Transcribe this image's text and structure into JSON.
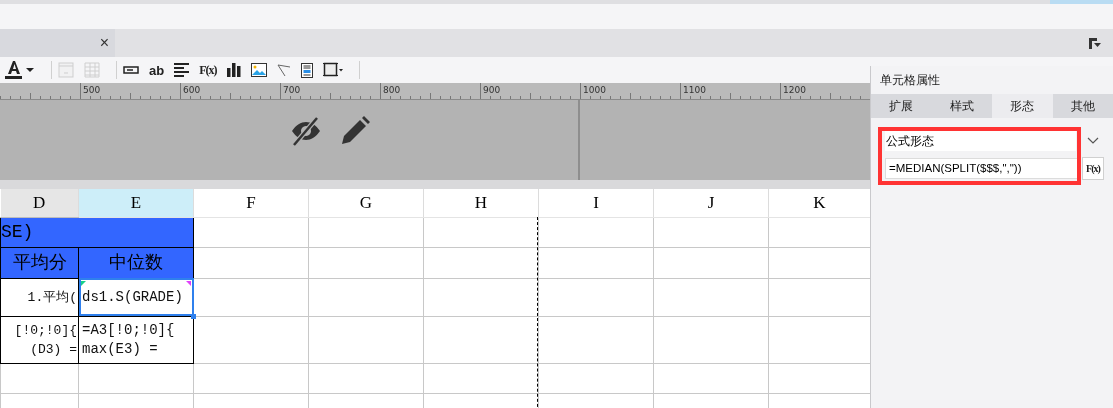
{
  "document_tab": {
    "close_glyph": "×",
    "selected": true
  },
  "toolbar": [
    {
      "kind": "font-color",
      "disabled": false
    },
    {
      "kind": "separator"
    },
    {
      "kind": "frame",
      "disabled": true
    },
    {
      "kind": "grid",
      "disabled": true
    },
    {
      "kind": "separator"
    },
    {
      "kind": "textbox",
      "disabled": false
    },
    {
      "kind": "text",
      "label": "ab",
      "disabled": false
    },
    {
      "kind": "align",
      "disabled": false
    },
    {
      "kind": "formula",
      "label": "F(x)",
      "disabled": false
    },
    {
      "kind": "chart",
      "disabled": false
    },
    {
      "kind": "image",
      "disabled": false
    },
    {
      "kind": "slash",
      "disabled": false
    },
    {
      "kind": "report",
      "disabled": false
    },
    {
      "kind": "border",
      "disabled": false
    },
    {
      "kind": "separator"
    }
  ],
  "ruler": {
    "labels": [
      "500",
      "600",
      "700",
      "800",
      "900",
      "1000",
      "1100",
      "1200"
    ]
  },
  "sheet": {
    "columns": [
      {
        "label": "D",
        "selected": false,
        "shaded": true
      },
      {
        "label": "E",
        "selected": true,
        "shaded": false
      },
      {
        "label": "F",
        "selected": false,
        "shaded": false
      },
      {
        "label": "G",
        "selected": false,
        "shaded": false
      },
      {
        "label": "H",
        "selected": false,
        "shaded": false
      },
      {
        "label": "I",
        "selected": false,
        "shaded": false
      },
      {
        "label": "J",
        "selected": false,
        "shaded": false
      },
      {
        "label": "K",
        "selected": false,
        "shaded": false
      }
    ],
    "rows": [
      {
        "cells": [
          {
            "text": "SE)",
            "kind": "header",
            "selected": false
          },
          {
            "kind": "header",
            "selected": false
          }
        ]
      },
      {
        "cells": [
          {
            "text": "平均分",
            "kind": "header",
            "selected": false
          },
          {
            "text": "中位数",
            "kind": "header",
            "selected": false
          }
        ]
      },
      {
        "cells": [
          {
            "text": "1.平均(",
            "kind": "data",
            "selected": false
          },
          {
            "text": "ds1.S(GRADE)",
            "kind": "data",
            "selected": true
          }
        ]
      },
      {
        "cells": [
          {
            "text": "[!0;!0]{\n(D3) =",
            "kind": "data",
            "selected": false
          },
          {
            "text": "=A3[!0;!0]{\nmax(E3) =",
            "kind": "data",
            "selected": false
          }
        ]
      },
      {
        "cells": []
      },
      {
        "cells": []
      }
    ]
  },
  "properties_panel": {
    "title": "单元格属性",
    "tabs": [
      {
        "label": "扩展",
        "selected": false
      },
      {
        "label": "样式",
        "selected": false
      },
      {
        "label": "形态",
        "selected": true
      },
      {
        "label": "其他",
        "selected": false
      }
    ],
    "form_select": {
      "value": "公式形态"
    },
    "formula": {
      "value": "=MEDIAN(SPLIT($$$,\",\"))"
    },
    "formula_button": {
      "label": "F(x)"
    }
  }
}
